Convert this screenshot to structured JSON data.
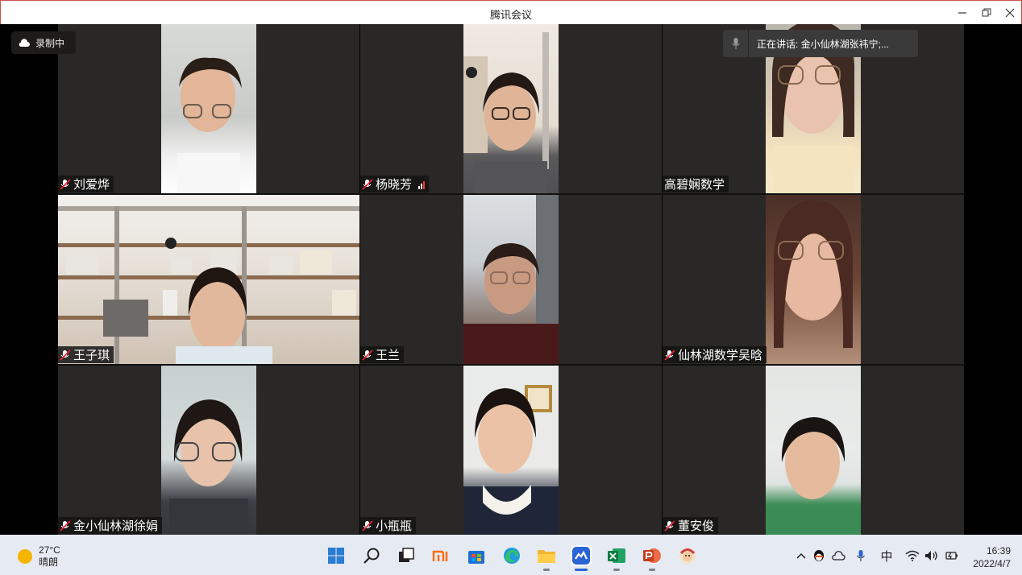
{
  "window": {
    "title": "腾讯会议"
  },
  "recording": {
    "label": "录制中"
  },
  "speaking": {
    "label": "正在讲话: 金小仙林湖张祎宁;..."
  },
  "participants": [
    {
      "name": "刘爱烨",
      "muted": true
    },
    {
      "name": "杨晓芳",
      "muted": true,
      "signal": true
    },
    {
      "name": "高碧娴数学",
      "muted": false
    },
    {
      "name": "王子琪",
      "muted": true
    },
    {
      "name": "王兰",
      "muted": true
    },
    {
      "name": "仙林湖数学吴晗",
      "muted": true
    },
    {
      "name": "金小仙林湖徐娟",
      "muted": true
    },
    {
      "name": "小瓶瓶",
      "muted": true
    },
    {
      "name": "董安俊",
      "muted": true
    }
  ],
  "taskbar": {
    "weather": {
      "temp": "27°C",
      "desc": "晴朗"
    },
    "ime": "中",
    "time": "16:39",
    "date": "2022/4/7"
  },
  "colors": {
    "accent": "#2a64d6",
    "tile_bg": "#2a2826"
  }
}
